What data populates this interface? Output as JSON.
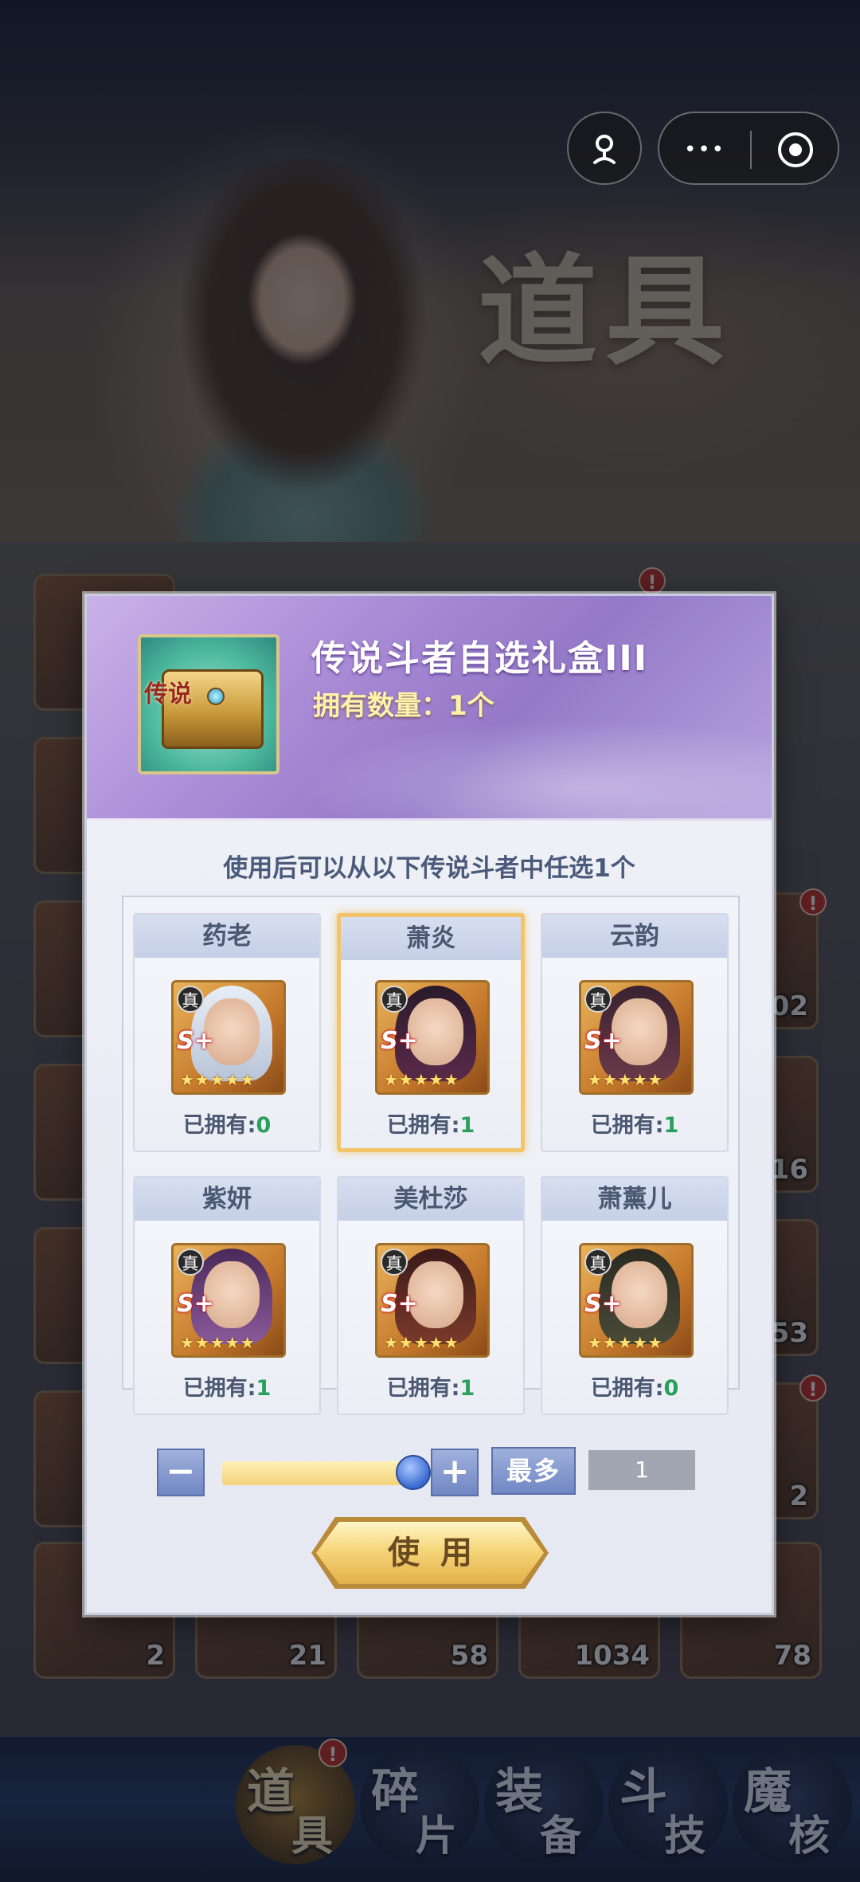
{
  "background": {
    "title_art": "道具",
    "tile_counts": [
      "02",
      "16",
      "53",
      "2",
      "2",
      "21",
      "58",
      "1034",
      "78"
    ],
    "nav": [
      {
        "c1": "道",
        "c2": "具"
      },
      {
        "c1": "碎",
        "c2": "片"
      },
      {
        "c1": "装",
        "c2": "备"
      },
      {
        "c1": "斗",
        "c2": "技"
      },
      {
        "c1": "魔",
        "c2": "核"
      }
    ],
    "badge": "!"
  },
  "modal": {
    "item_label": "传说",
    "title": "传说斗者自选礼盒III",
    "owned_count": "拥有数量：1个",
    "instruction": "使用后可以从以下传说斗者中任选1个",
    "heroes": [
      {
        "name": "药老",
        "owned_label": "已拥有:",
        "owned_value": "0"
      },
      {
        "name": "萧炎",
        "owned_label": "已拥有:",
        "owned_value": "1"
      },
      {
        "name": "云韵",
        "owned_label": "已拥有:",
        "owned_value": "1"
      },
      {
        "name": "紫妍",
        "owned_label": "已拥有:",
        "owned_value": "1"
      },
      {
        "name": "美杜莎",
        "owned_label": "已拥有:",
        "owned_value": "1"
      },
      {
        "name": "萧薰儿",
        "owned_label": "已拥有:",
        "owned_value": "0"
      }
    ],
    "selected_hero": "萧炎",
    "portrait_zhen": "真",
    "portrait_rank": "S+",
    "portrait_stars": "★★★★★",
    "minus_label": "−",
    "plus_label": "+",
    "max_label": "最多",
    "quantity": "1",
    "slider_fraction": 1.0,
    "use_label": "使用"
  },
  "capsule": {
    "more_glyph": "•••"
  }
}
